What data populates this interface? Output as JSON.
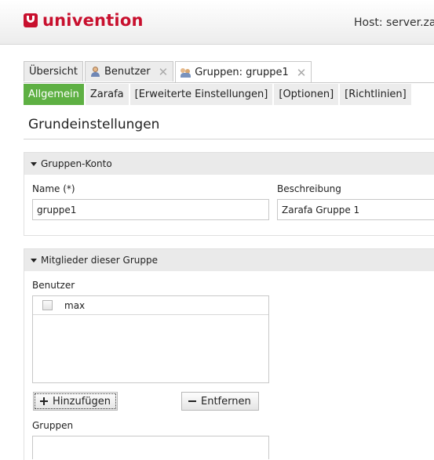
{
  "header": {
    "brand": "univention",
    "host_label": "Host: server.za"
  },
  "tabs": [
    {
      "label": "Übersicht"
    },
    {
      "label": "Benutzer",
      "icon": "user-icon",
      "close": "✕"
    },
    {
      "label": "Gruppen: gruppe1",
      "icon": "group-icon",
      "close": "✕"
    }
  ],
  "subtabs": [
    {
      "label": "Allgemein"
    },
    {
      "label": "Zarafa"
    },
    {
      "label": "[Erweiterte Einstellungen]"
    },
    {
      "label": "[Optionen]"
    },
    {
      "label": "[Richtlinien]"
    }
  ],
  "page_title": "Grundeinstellungen",
  "section_account": {
    "title": "Gruppen-Konto",
    "name_label": "Name (*)",
    "name_value": "gruppe1",
    "desc_label": "Beschreibung",
    "desc_value": "Zarafa Gruppe 1"
  },
  "section_members": {
    "title": "Mitglieder dieser Gruppe",
    "users_label": "Benutzer",
    "users": [
      "max"
    ],
    "add_button": "Hinzufügen",
    "remove_button": "Entfernen",
    "groups_label": "Gruppen"
  },
  "colors": {
    "brand": "#c8102e",
    "active_subtab": "#5eb043"
  }
}
